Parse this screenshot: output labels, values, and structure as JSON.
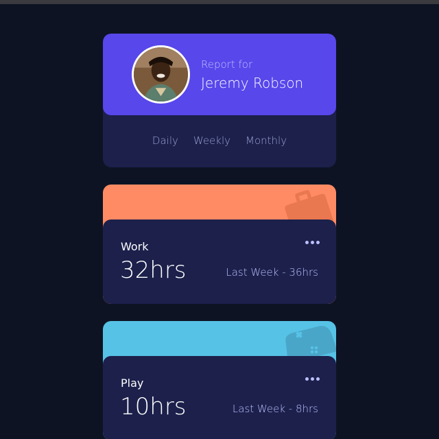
{
  "profile": {
    "report_label": "Report for",
    "name": "Jeremy Robson"
  },
  "tabs": [
    "Daily",
    "Weekly",
    "Monthly"
  ],
  "activities": [
    {
      "title": "Work",
      "hours": "32hrs",
      "previous": "Last Week - 36hrs",
      "color": "#ff8b64",
      "icon": "briefcase-icon"
    },
    {
      "title": "Play",
      "hours": "10hrs",
      "previous": "Last Week - 8hrs",
      "color": "#56c2e6",
      "icon": "gamepad-icon"
    }
  ],
  "colors": {
    "background": "#0e1323",
    "card": "#1c204b",
    "accent": "#5847eb",
    "muted_text": "#bbc0ff"
  }
}
